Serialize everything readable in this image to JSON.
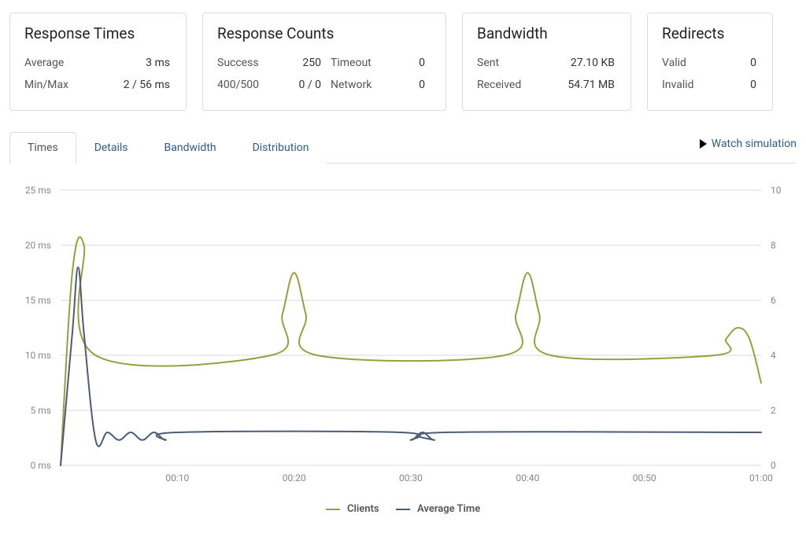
{
  "cards": {
    "response_times": {
      "title": "Response Times",
      "average_label": "Average",
      "average_value": "3 ms",
      "minmax_label": "Min/Max",
      "minmax_value": "2 / 56 ms"
    },
    "response_counts": {
      "title": "Response Counts",
      "success_label": "Success",
      "success_value": "250",
      "timeout_label": "Timeout",
      "timeout_value": "0",
      "err_label": "400/500",
      "err_value": "0 / 0",
      "network_label": "Network",
      "network_value": "0"
    },
    "bandwidth": {
      "title": "Bandwidth",
      "sent_label": "Sent",
      "sent_value": "27.10 KB",
      "recv_label": "Received",
      "recv_value": "54.71 MB"
    },
    "redirects": {
      "title": "Redirects",
      "valid_label": "Valid",
      "valid_value": "0",
      "invalid_label": "Invalid",
      "invalid_value": "0"
    }
  },
  "tabs": {
    "times": "Times",
    "details": "Details",
    "bandwidth": "Bandwidth",
    "distribution": "Distribution",
    "active": "times"
  },
  "watch_label": "Watch simulation",
  "legend": {
    "clients": "Clients",
    "avg": "Average Time"
  },
  "axes": {
    "left_unit": "ms",
    "left_ticks": [
      "25 ms",
      "20 ms",
      "15 ms",
      "10 ms",
      "5 ms",
      "0 ms"
    ],
    "right_ticks": [
      "10",
      "8",
      "6",
      "4",
      "2",
      "0"
    ],
    "x_ticks": [
      "00:10",
      "00:20",
      "00:30",
      "00:40",
      "00:50",
      "01:00"
    ]
  },
  "chart_data": {
    "type": "line",
    "xlabel": "",
    "xlim_seconds": [
      0,
      60
    ],
    "left_axis": {
      "label": "ms",
      "range": [
        0,
        25
      ]
    },
    "right_axis": {
      "label": "",
      "range": [
        0,
        10
      ]
    },
    "x_ticks": [
      "00:10",
      "00:20",
      "00:30",
      "00:40",
      "00:50",
      "01:00"
    ],
    "series": [
      {
        "name": "Clients",
        "axis": "right",
        "color": "#95a23c",
        "x_seconds": [
          0,
          1,
          2,
          3,
          18,
          19,
          20,
          21,
          22,
          38,
          39,
          40,
          41,
          42,
          56,
          57,
          58,
          59,
          60
        ],
        "values": [
          0,
          7,
          8,
          4,
          4,
          5.5,
          7,
          5.5,
          4,
          4,
          5.5,
          7,
          5.5,
          4,
          4,
          4.6,
          5,
          4.6,
          3
        ]
      },
      {
        "name": "Average Time",
        "axis": "left",
        "color": "#4a5c78",
        "x_seconds": [
          0,
          1,
          1.5,
          2,
          3,
          4,
          5,
          6,
          7,
          8,
          9,
          10,
          29,
          30,
          31,
          32,
          33,
          60
        ],
        "values": [
          0,
          12,
          18,
          12,
          2.3,
          3,
          2.3,
          3,
          2.3,
          3,
          2.3,
          3,
          3,
          2.3,
          3,
          2.3,
          3,
          3
        ]
      }
    ]
  },
  "colors": {
    "grid": "#d8d8d8",
    "axis_text": "#888888",
    "clients": "#95a23c",
    "avg": "#4a5c78",
    "link": "#2e5d8a"
  }
}
